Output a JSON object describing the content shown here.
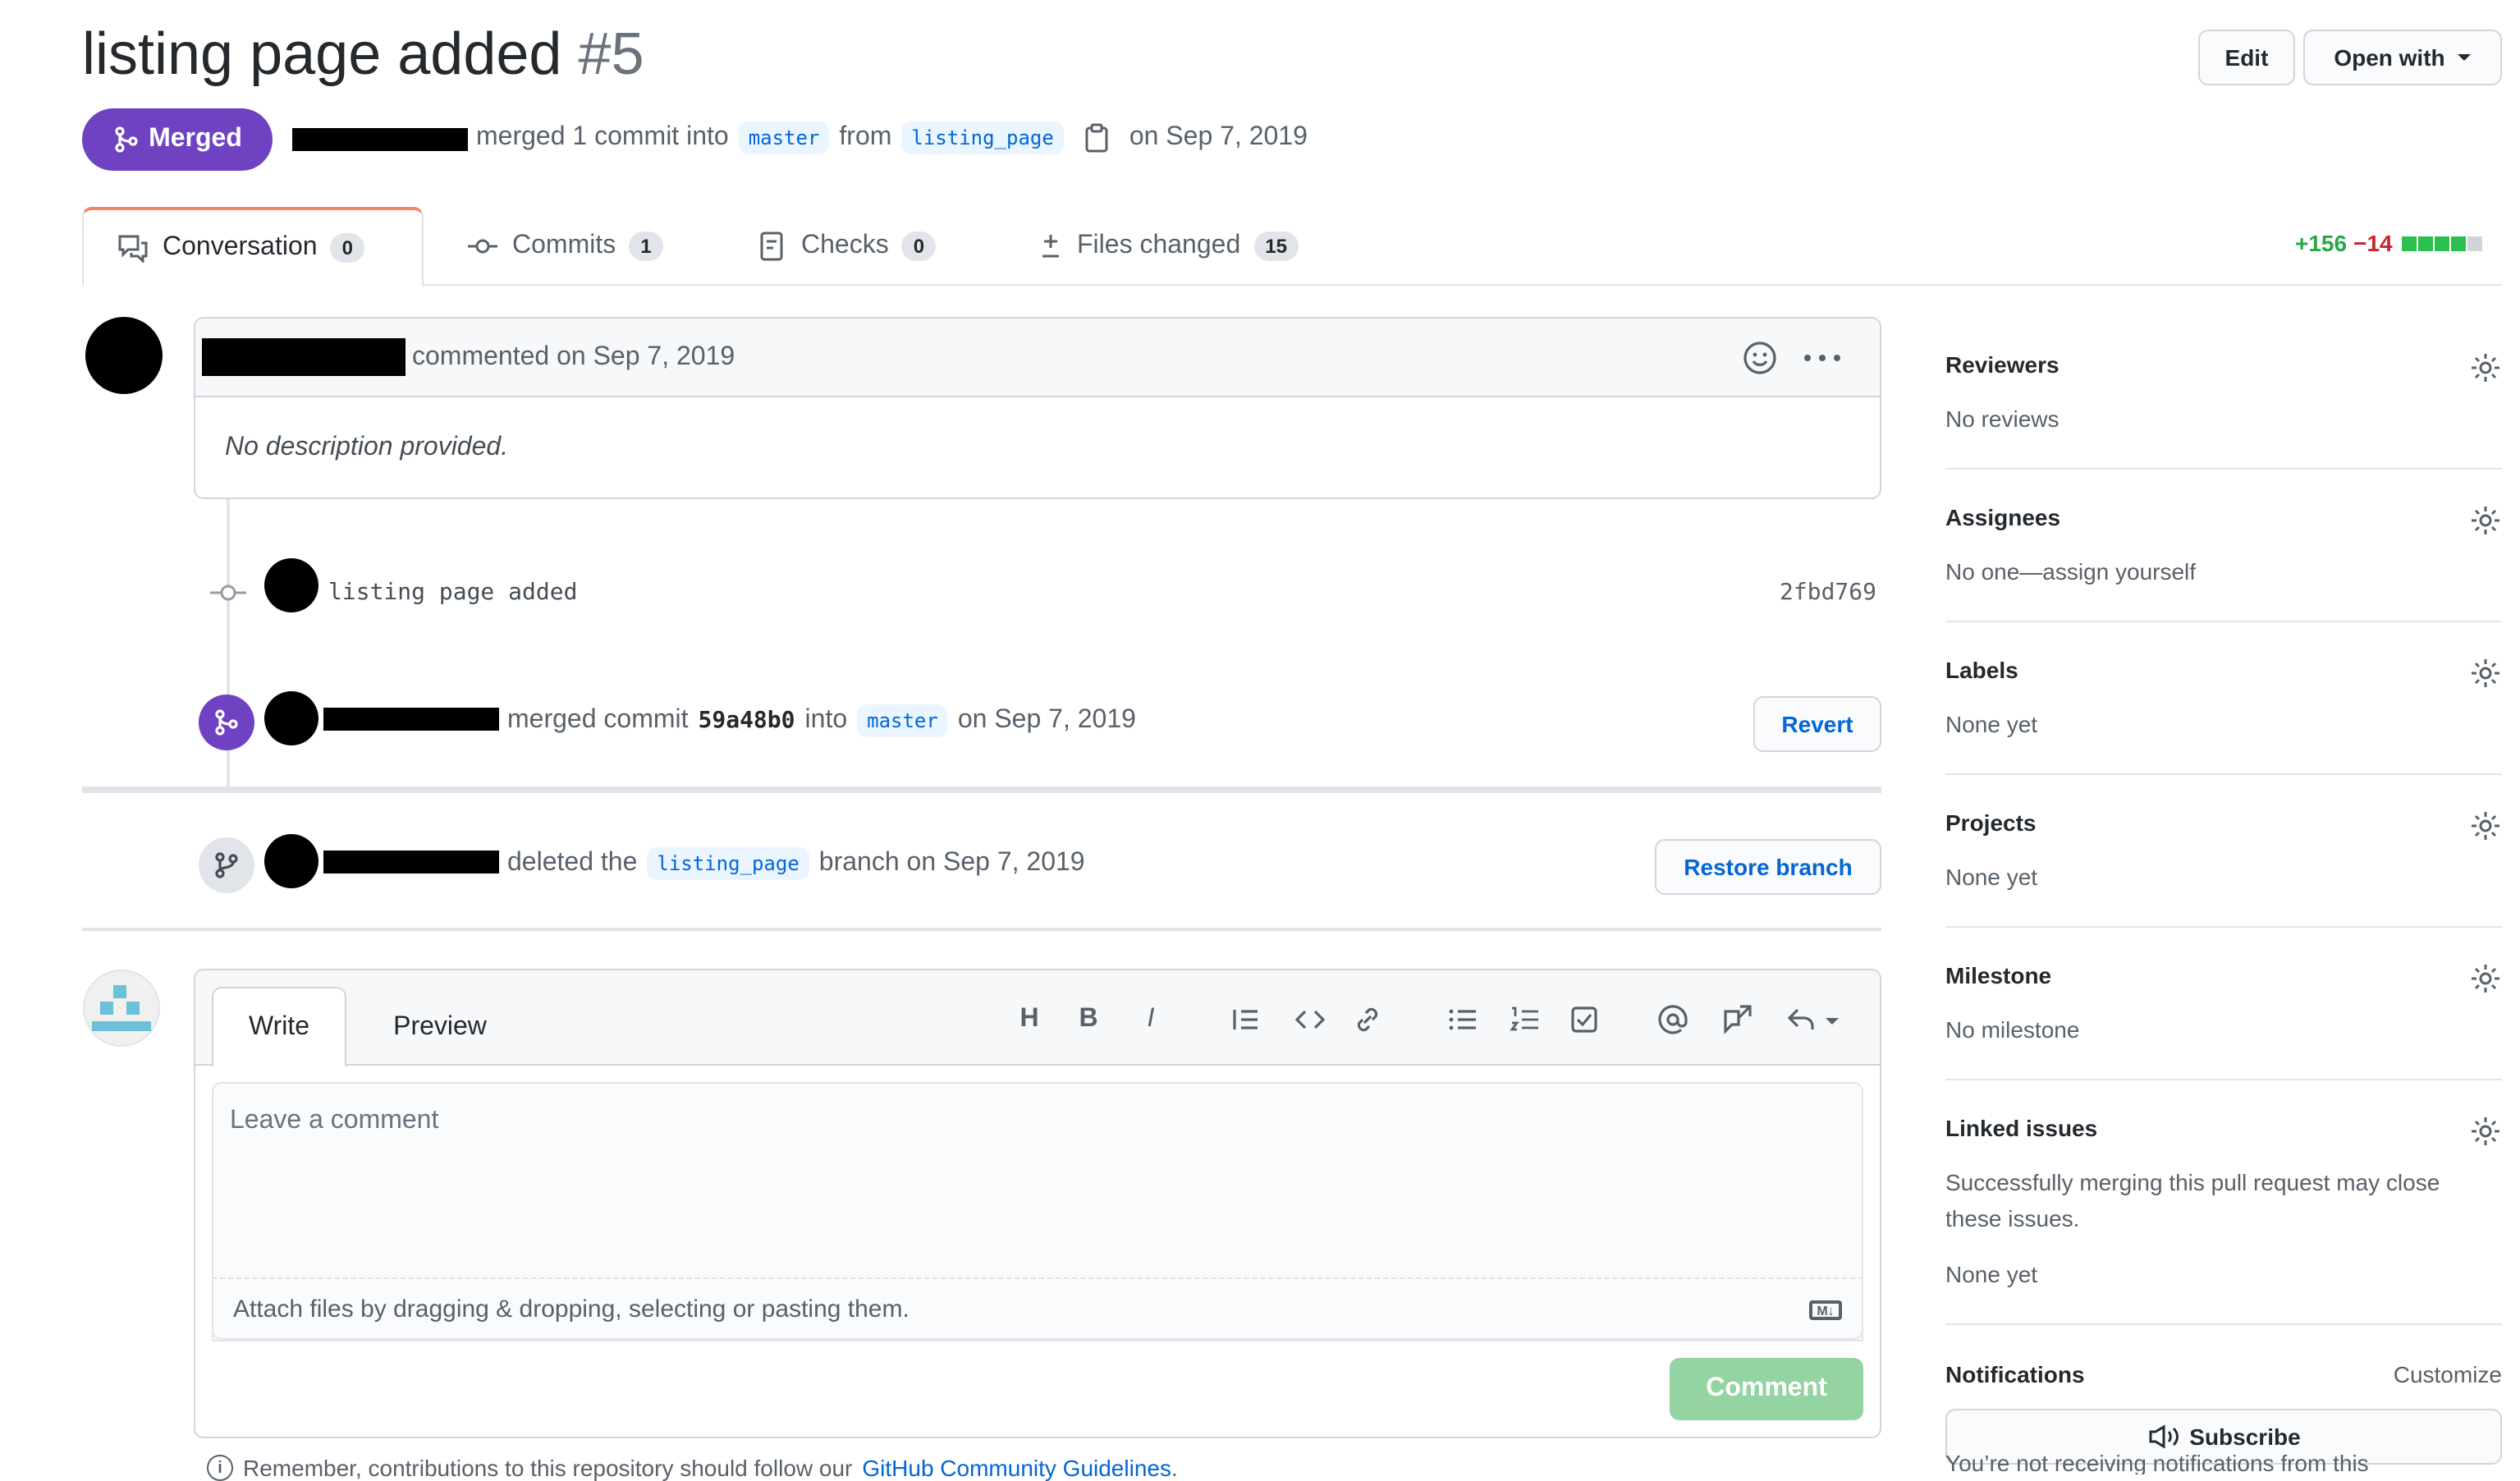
{
  "pr": {
    "title": "listing page added",
    "number": "#5",
    "state": "Merged",
    "meta_action": "merged 1 commit into",
    "meta_from": "from",
    "base_branch": "master",
    "head_branch": "listing_page",
    "meta_date": "on Sep 7, 2019"
  },
  "header": {
    "edit_label": "Edit",
    "open_with_label": "Open with"
  },
  "tabs": [
    {
      "label": "Conversation",
      "count": "0"
    },
    {
      "label": "Commits",
      "count": "1"
    },
    {
      "label": "Checks",
      "count": "0"
    },
    {
      "label": "Files changed",
      "count": "15"
    }
  ],
  "diffstat": {
    "additions": "+156",
    "deletions": "−14"
  },
  "comment": {
    "action": "commented on Sep 7, 2019",
    "body": "No description provided."
  },
  "timeline": {
    "commit": {
      "message": "listing page added",
      "sha": "2fbd769"
    },
    "merge": {
      "text1": "merged commit",
      "sha": "59a48b0",
      "text2": "into",
      "branch": "master",
      "date": "on Sep 7, 2019",
      "button": "Revert"
    },
    "delete": {
      "text1": "deleted the",
      "branch": "listing_page",
      "text2": "branch on Sep 7, 2019",
      "button": "Restore branch"
    }
  },
  "editor": {
    "write_tab": "Write",
    "preview_tab": "Preview",
    "placeholder": "Leave a comment",
    "attach_text": "Attach files by dragging & dropping, selecting or pasting them.",
    "comment_button": "Comment",
    "toolbar": [
      "H",
      "B",
      "I"
    ]
  },
  "footer": {
    "prefix": "Remember, contributions to this repository should follow our",
    "link": "GitHub Community Guidelines",
    "suffix": "."
  },
  "sidebar": {
    "reviewers": {
      "title": "Reviewers",
      "value": "No reviews"
    },
    "assignees": {
      "title": "Assignees",
      "value": "No one—assign yourself"
    },
    "labels": {
      "title": "Labels",
      "value": "None yet"
    },
    "projects": {
      "title": "Projects",
      "value": "None yet"
    },
    "milestone": {
      "title": "Milestone",
      "value": "No milestone"
    },
    "linked_issues": {
      "title": "Linked issues",
      "description": "Successfully merging this pull request may close these issues.",
      "value": "None yet"
    },
    "notifications": {
      "title": "Notifications",
      "customize": "Customize",
      "subscribe": "Subscribe",
      "note": "You’re not receiving notifications from this"
    }
  },
  "colors": {
    "merged": "#6f42c1",
    "link": "#0366d6",
    "add": "#28a745",
    "del": "#cb2431",
    "comment_btn": "#94d3a2"
  }
}
